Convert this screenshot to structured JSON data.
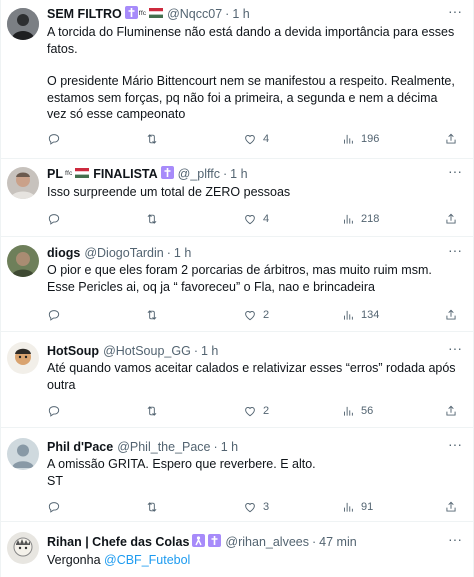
{
  "tweets": [
    {
      "name": "SEM FILTRO",
      "badge_text": "ᶠᶠᶜ",
      "handle": "@Nqcc07",
      "time": "1 h",
      "body": [
        "A torcida do Fluminense não está dando a devida importância para esses fatos.",
        "O presidente Mário Bittencourt nem se manifestou a respeito. Realmente, estamos sem forças, pq não foi a primeira, a segunda e nem a décima vez só esse campeonato"
      ],
      "likes": "4",
      "views": "196"
    },
    {
      "name": "PL",
      "badge_text": "ᶠᶠᶜ",
      "name_suffix": "FINALISTA",
      "handle": "@_plffc",
      "time": "1 h",
      "body": [
        "Isso surpreende um total de ZERO pessoas"
      ],
      "likes": "4",
      "views": "218"
    },
    {
      "name": "diogs",
      "handle": "@DiogoTardin",
      "time": "1 h",
      "body": [
        "O pior e que eles foram 2 porcarias de árbitros, mas muito ruim msm. Esse Pericles ai, oq ja “ favoreceu” o Fla, nao e brincadeira"
      ],
      "likes": "2",
      "views": "134"
    },
    {
      "name": "HotSoup",
      "handle": "@HotSoup_GG",
      "time": "1 h",
      "body": [
        "Até quando vamos aceitar calados e relativizar esses “erros” rodada após outra"
      ],
      "likes": "2",
      "views": "56"
    },
    {
      "name": "Phil d'Pace",
      "handle": "@Phil_the_Pace",
      "time": "1 h",
      "body": [
        "A omissão GRITA. Espero que reverbere. E alto.",
        "ST"
      ],
      "likes": "3",
      "views": "91"
    },
    {
      "name": "Rihan | Chefe das Colas",
      "handle": "@rihan_alvees",
      "time": "47 min",
      "body_prefix": "Vergonha ",
      "mention": "@CBF_Futebol"
    }
  ],
  "ui": {
    "dot": "·",
    "more": "···"
  },
  "colors": {
    "accent": "#1d9bf0",
    "muted": "#536471",
    "text": "#0f1419",
    "cross_badge": "#a78bfa",
    "flag_red": "#cd2a3e",
    "flag_green": "#436f4d"
  },
  "icons": [
    "reply-icon",
    "retweet-icon",
    "like-icon",
    "views-icon",
    "share-icon",
    "more-icon",
    "cross-icon",
    "flag-icon"
  ]
}
